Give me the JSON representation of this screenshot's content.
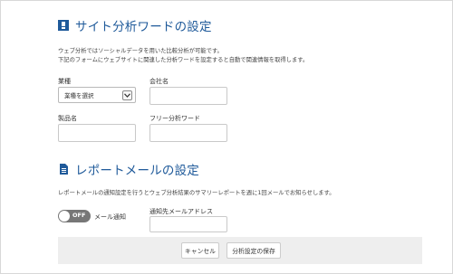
{
  "section1": {
    "title": "サイト分析ワードの設定",
    "desc_line1": "ウェブ分析ではソーシャルデータを用いた比較分析が可能です。",
    "desc_line2": "下記のフォームにウェブサイトに関連した分析ワードを設定すると自動で関連情報を取得します。",
    "industry_label": "業種",
    "industry_selected": "業種を選択",
    "company_label": "会社名",
    "company_value": "",
    "product_label": "製品名",
    "product_value": "",
    "freeword_label": "フリー分析ワード",
    "freeword_value": ""
  },
  "section2": {
    "title": "レポートメールの設定",
    "desc": "レポートメールの通知設定を行うとウェブ分析結果のサマリーレポートを週に1回メールでお知らせします。",
    "toggle_state": "OFF",
    "toggle_label": "メール通知",
    "email_label": "通知先メールアドレス",
    "email_value": ""
  },
  "footer": {
    "cancel_label": "キャンセル",
    "save_label": "分析設定の保存"
  },
  "colors": {
    "accent": "#1f5a9a",
    "toggle_off": "#777777",
    "footer_bg": "#eeeeee"
  },
  "icons": {
    "section1_icon": "flag-icon",
    "section2_icon": "document-icon",
    "select_icon": "chevron-down-icon"
  }
}
